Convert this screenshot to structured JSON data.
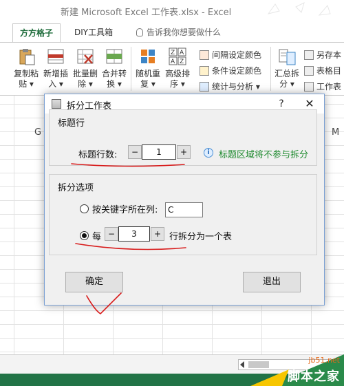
{
  "window": {
    "title": "新建 Microsoft Excel 工作表.xlsx - Excel"
  },
  "tabs": [
    {
      "label": "方方格子"
    },
    {
      "label": "DIY工具箱"
    },
    {
      "label": "告诉我你想要做什么"
    }
  ],
  "ribbon": {
    "copy_paste": {
      "line1": "复制粘",
      "line2": "贴 ▾"
    },
    "insert": {
      "line1": "新增插",
      "line2": "入 ▾"
    },
    "batch_delete": {
      "line1": "批量删",
      "line2": "除 ▾"
    },
    "merge": {
      "line1": "合并转",
      "line2": "换 ▾"
    },
    "random_sort": {
      "line1": "随机重",
      "line2": "复 ▾"
    },
    "advanced_sort": {
      "line1": "高级排",
      "line2": "序 ▾"
    },
    "interval_color": "间隔设定颜色",
    "cond_color": "条件设定颜色",
    "stats": "统计与分析 ▾",
    "summary_split": {
      "line1": "汇总拆",
      "line2": "分 ▾"
    },
    "save_as": "另存本",
    "sheet_dir": "表格目",
    "worksheet": "工作表"
  },
  "sheet": {
    "col_g": "G",
    "col_m": "M"
  },
  "dialog": {
    "title": "拆分工作表",
    "help": "?",
    "close": "✕",
    "header_group": {
      "title": "标题行",
      "rows_label": "标题行数:",
      "rows_value": "1",
      "minus": "−",
      "plus": "+",
      "info_icon": "i",
      "info_text": "标题区域将不参与拆分"
    },
    "split_group": {
      "title": "拆分选项",
      "opt_keyword_label": "按关键字所在列:",
      "keyword_column": "C",
      "opt_every_label": "每",
      "every_value": "3",
      "minus": "−",
      "plus": "+",
      "every_suffix": "行拆分为一个表",
      "selected": "every"
    },
    "ok_label": "确定",
    "cancel_label": "退出"
  },
  "watermark": {
    "site": "jb51.net",
    "name": "脚本之家"
  },
  "colors": {
    "annotation_red": "#d81c1c",
    "excel_green": "#217346",
    "info_green": "#1e8a2e"
  }
}
